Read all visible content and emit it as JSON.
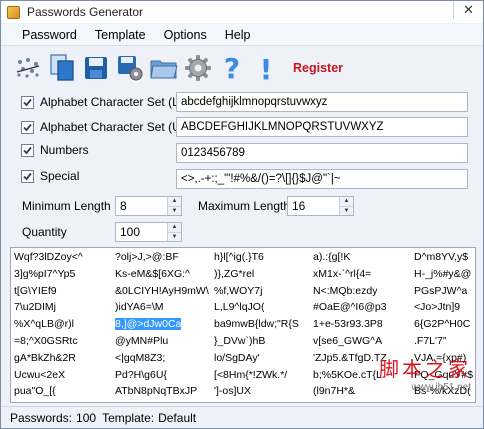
{
  "window": {
    "title": "Passwords Generator",
    "close_glyph": "✕"
  },
  "menu": [
    "Password",
    "Template",
    "Options",
    "Help"
  ],
  "toolbar": {
    "icons": [
      "magic-wand-icon",
      "copy-icon",
      "save-icon",
      "save-settings-icon",
      "open-folder-icon",
      "gear-icon",
      "help-icon",
      "info-icon"
    ],
    "register_label": "Register"
  },
  "charsets": [
    {
      "label": "Alphabet Character Set (L)",
      "value": "abcdefghijklmnopqrstuvwxyz",
      "checked": true
    },
    {
      "label": "Alphabet Character Set (U)",
      "value": "ABCDEFGHIJKLMNOPQRSTUVWXYZ",
      "checked": true
    },
    {
      "label": "Numbers",
      "value": "0123456789",
      "checked": true
    },
    {
      "label": "Special",
      "value": "<>,.-+:;_\"'!#%&/()=?\\[]{}$J@\"`|~",
      "checked": true
    }
  ],
  "length": {
    "min_label": "Minimum Length",
    "min_value": "8",
    "max_label": "Maximum Length",
    "max_value": "16",
    "quantity_label": "Quantity",
    "quantity_value": "100"
  },
  "passwords": [
    [
      "Wqf?3lDZoy<^",
      "?olj>J,>@:BF",
      "h}l[^ig(.}T6",
      "a).:{g[!K",
      "D^m8YV,y$"
    ],
    [
      "3]g%pI7^Yp5",
      "Ks-eM&$[6XG:^",
      ")},ZG*rel",
      "xM1x-`^rl{4=",
      "H-_j%#y&@"
    ],
    [
      "t[G\\YIEf9",
      "&0LCIYH!AyH9mW\\",
      "%f,WOY7j",
      "N<:MQb:ezdy",
      "PGsPJW^a"
    ],
    [
      "7\\u2DIMj",
      ")idYA6=\\M",
      "L,L9^lqJO(",
      "#OaE@^I6@p3",
      "<Jo>Jtn]9"
    ],
    [
      "%X^qLB@r)l",
      "8,]@>dJw0Ca",
      "ba9mwB{ldw;\"R{S",
      "1+e-53r93.3P8",
      "6{G2P^H0C"
    ],
    [
      "=8;^X0GSRtc",
      "@yMN#Plu",
      "}_DVw`)hB",
      "v[se6_GWG^A",
      ".F7L'7\""
    ],
    [
      "gA*BkZh&2R",
      "<|gqM8Z3;",
      "lo/SgDAy'",
      "'ZJp5.&TfgD.TZ",
      "VJA.={xp#)"
    ],
    [
      "Ucwu<2eX",
      "Pd?H\\g6U{",
      "[<8Hm{*!ZWk.*/",
      "b;%5KOe.cT{L",
      "FQ_GquY#$"
    ],
    [
      "pua\"O_[{",
      "ATbN8pNqTBxJP",
      "']-os]UX",
      "(l9n7H*&",
      "Bs-%/kXzD("
    ]
  ],
  "selected_password": "8,]@>dJw0Ca",
  "watermark": {
    "chinese": "脚本之家",
    "url": "www.jb51.net"
  },
  "status": {
    "passwords_label": "Passwords:",
    "passwords_count": "100",
    "template_label": "Template:",
    "template_name": "Default"
  }
}
